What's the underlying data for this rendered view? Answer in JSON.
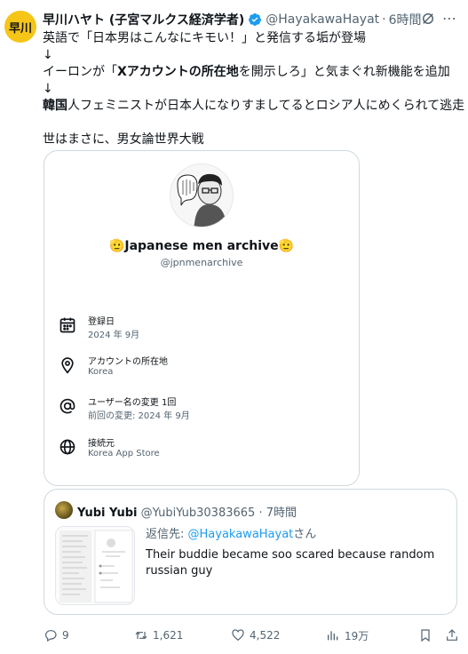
{
  "post": {
    "avatar_text": "早川",
    "author_name": "早川ハヤト (子宮マルクス経済学者)",
    "handle": "@HayakawaHayat",
    "separator": "·",
    "time": "6時間",
    "lines": {
      "l1": "英語で「日本男はこんなにキモい！」と発信する垢が登場",
      "l2": "↓",
      "l3_pre": "イーロンが「",
      "l3_bold": "Xアカウントの所在地",
      "l3_post": "を開示しろ」と気まぐれ新機能を追加",
      "l4": "↓",
      "l5_bold": "韓国",
      "l5_post": "人フェミニストが日本人になりすましてるとロシア人にめくられて逃走",
      "l7": "世はまさに、男女論世界大戦"
    }
  },
  "card": {
    "emoji_left": "🫡",
    "name": "Japanese men archive",
    "emoji_right": "🫡",
    "handle": "@jpnmenarchive",
    "rows": [
      {
        "icon": "calendar-icon",
        "title": "登録日",
        "value": "2024 年 9月"
      },
      {
        "icon": "location-pin-icon",
        "title": "アカウントの所在地",
        "value": "Korea"
      },
      {
        "icon": "at-sign-icon",
        "title": "ユーザー名の変更 1回",
        "value": "前回の変更: 2024 年 9月"
      },
      {
        "icon": "globe-icon",
        "title": "接続元",
        "value": "Korea App Store"
      }
    ]
  },
  "quote": {
    "author_name": "Yubi Yubi",
    "handle": "@YubiYub30383665",
    "separator": "·",
    "time": "7時間",
    "reply_prefix": "返信先: ",
    "reply_handle": "@HayakawaHayat",
    "reply_suffix": "さん",
    "text": "Their buddie became soo scared because random russian guy"
  },
  "actions": {
    "replies": "9",
    "reposts": "1,621",
    "likes": "4,522",
    "views": "19万"
  },
  "colors": {
    "accent": "#1d9bf0",
    "muted": "#536471",
    "border": "#cfd9de",
    "avatar_bg": "#f5c518"
  }
}
